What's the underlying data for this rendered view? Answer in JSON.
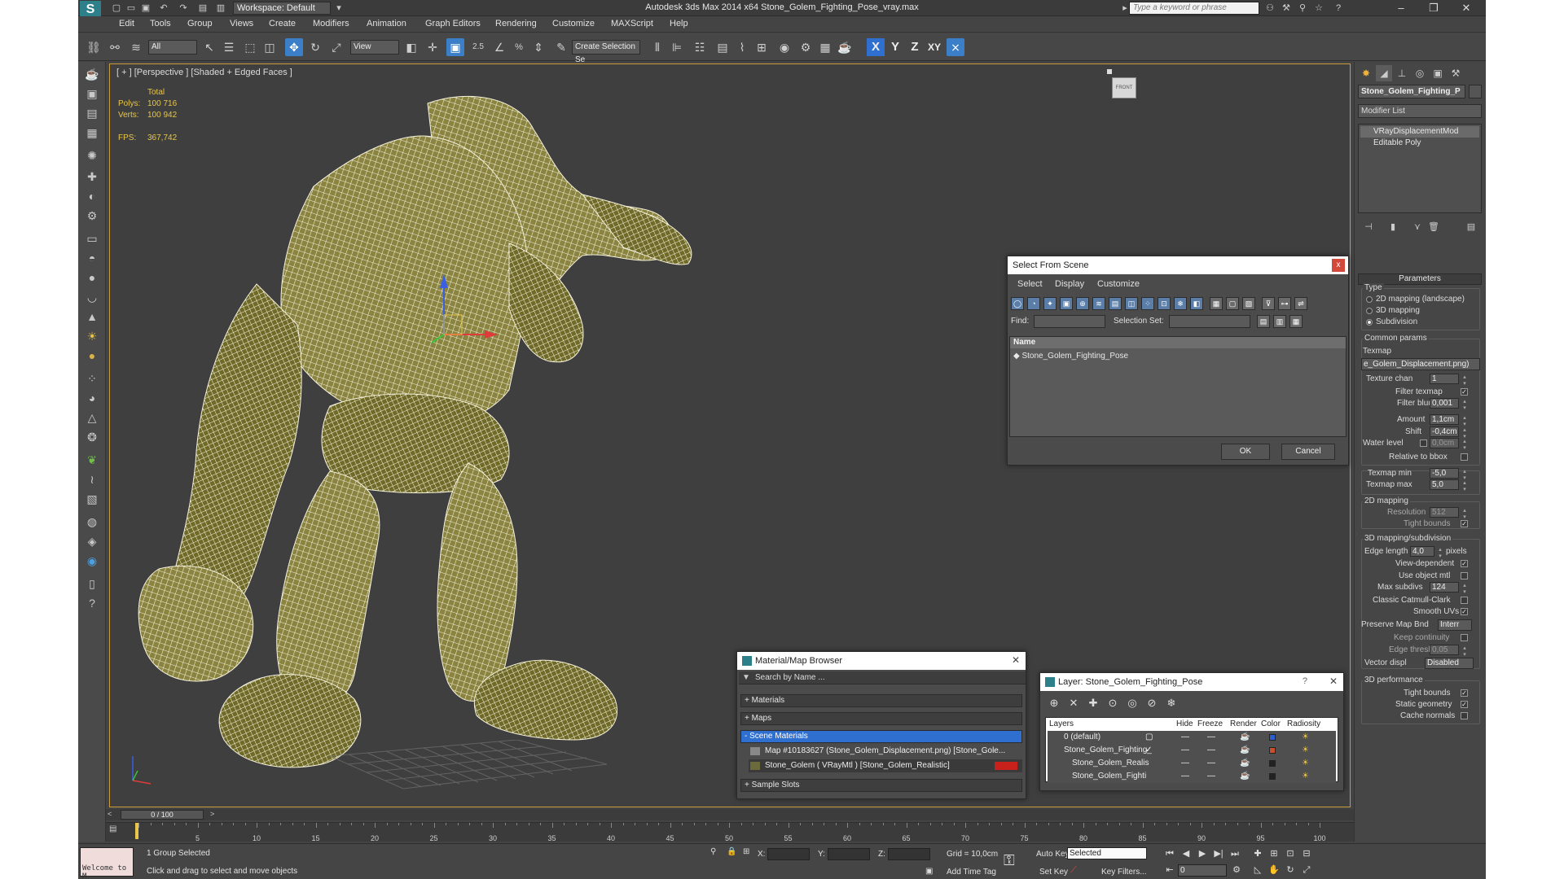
{
  "titlebar": {
    "workspace": "Workspace: Default",
    "title": "Autodesk 3ds Max  2014 x64    Stone_Golem_Fighting_Pose_vray.max",
    "search_placeholder": "Type a keyword or phrase"
  },
  "menu": [
    "Edit",
    "Tools",
    "Group",
    "Views",
    "Create",
    "Modifiers",
    "Animation",
    "Graph Editors",
    "Rendering",
    "Customize",
    "MAXScript",
    "Help"
  ],
  "toolbar": {
    "filter": "All",
    "ref_coord": "View",
    "selection_set": "Create Selection Se",
    "snap_label": "2.5",
    "axes": [
      "X",
      "Y",
      "Z",
      "XY"
    ]
  },
  "viewport": {
    "label": "[ + ] [Perspective ] [Shaded + Edged Faces ]",
    "stats": {
      "total": "Total",
      "polys_label": "Polys:",
      "polys": "100 716",
      "verts_label": "Verts:",
      "verts": "100 942",
      "fps_label": "FPS:",
      "fps": "367,742"
    },
    "viewcube": "FRONT",
    "colors": {
      "wire": "#f4f0d8",
      "stone": "#7a7a2e",
      "frame": "#c89b3b"
    }
  },
  "command_panel": {
    "object_name": "Stone_Golem_Fighting_P",
    "modifier_list": "Modifier List",
    "stack": [
      "VRayDisplacementMod",
      "Editable Poly"
    ],
    "params_title": "Parameters",
    "type_label": "Type",
    "type_options": [
      "2D mapping (landscape)",
      "3D mapping",
      "Subdivision"
    ],
    "type_selected": 2,
    "common_label": "Common params",
    "texmap_label": "Texmap",
    "texmap_value": "e_Golem_Displacement.png)",
    "texture_chan_label": "Texture chan",
    "texture_chan": "1",
    "filter_texmap": "Filter texmap",
    "filter_blur_label": "Filter blur",
    "filter_blur": "0,001",
    "amount_label": "Amount",
    "amount": "1,1cm",
    "shift_label": "Shift",
    "shift": "-0,4cm",
    "water_label": "Water level",
    "water": "0,0cm",
    "relative_bbox": "Relative to bbox",
    "texmap_min_label": "Texmap min",
    "texmap_min": "-5,0",
    "texmap_max_label": "Texmap max",
    "texmap_max": "5,0",
    "map2d_label": "2D mapping",
    "resolution_label": "Resolution",
    "resolution": "512",
    "tight_bounds": "Tight bounds",
    "map3d_label": "3D mapping/subdivision",
    "edge_length_label": "Edge length",
    "edge_length": "4,0",
    "pixels": "pixels",
    "view_dependent": "View-dependent",
    "use_object_mtl": "Use object mtl",
    "max_subdivs_label": "Max subdivs",
    "max_subdivs": "124",
    "catmull": "Classic Catmull-Clark",
    "smooth_uvs": "Smooth UVs",
    "preserve_label": "Preserve Map Bnd",
    "preserve": "Interr",
    "keep_continuity": "Keep continuity",
    "edge_thresh_label": "Edge thresh",
    "edge_thresh": "0,05",
    "vector_displ_label": "Vector displ",
    "vector_displ": "Disabled",
    "perf_label": "3D performance",
    "perf_tight": "Tight bounds",
    "static_geo": "Static geometry",
    "cache_normals": "Cache normals"
  },
  "select_from_scene": {
    "title": "Select From Scene",
    "menu": [
      "Select",
      "Display",
      "Customize"
    ],
    "find_label": "Find:",
    "selection_set_label": "Selection Set:",
    "column": "Name",
    "items": [
      "Stone_Golem_Fighting_Pose"
    ],
    "ok": "OK",
    "cancel": "Cancel"
  },
  "material_browser": {
    "title": "Material/Map Browser",
    "search": "Search by Name ...",
    "groups": [
      "+ Materials",
      "+ Maps",
      "- Scene Materials",
      "+ Sample Slots"
    ],
    "items": [
      "Map #10183627 (Stone_Golem_Displacement.png) [Stone_Gole...",
      "Stone_Golem  ( VRayMtl )  [Stone_Golem_Realistic]"
    ]
  },
  "layer_dialog": {
    "title": "Layer: Stone_Golem_Fighting_Pose",
    "columns": [
      "Layers",
      "Hide",
      "Freeze",
      "Render",
      "Color",
      "Radiosity"
    ],
    "rows": [
      {
        "name": "0 (default)",
        "color": "#2a5fd0"
      },
      {
        "name": "Stone_Golem_Fighting_",
        "color": "#c8502a"
      },
      {
        "name": "Stone_Golem_Realis",
        "color": "#222222"
      },
      {
        "name": "Stone_Golem_Fighti",
        "color": "#222222"
      }
    ]
  },
  "timeline": {
    "slider": "0 / 100",
    "ticks": [
      0,
      5,
      10,
      15,
      20,
      25,
      30,
      35,
      40,
      45,
      50,
      55,
      60,
      65,
      70,
      75,
      80,
      85,
      90,
      95,
      100
    ]
  },
  "status": {
    "welcome": "Welcome to M",
    "selected": "1 Group Selected",
    "prompt": "Click and drag to select and move objects",
    "x_label": "X:",
    "y_label": "Y:",
    "z_label": "Z:",
    "grid": "Grid = 10,0cm",
    "add_time_tag": "Add Time Tag",
    "auto_key": "Auto Key",
    "set_key": "Set Key",
    "selected_drop": "Selected",
    "key_filters": "Key Filters...",
    "frame": "0"
  }
}
